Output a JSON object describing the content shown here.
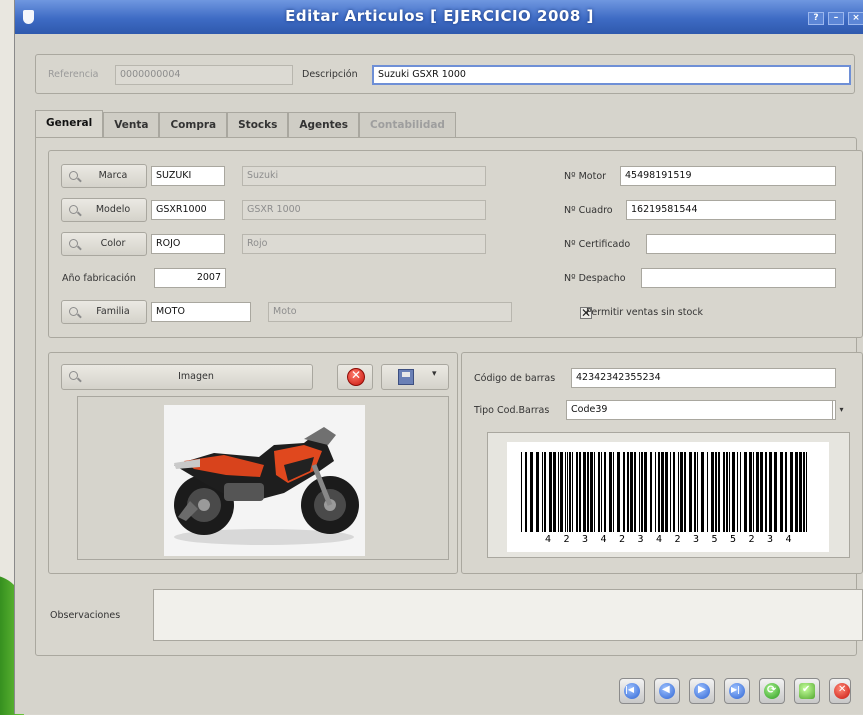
{
  "window": {
    "title": "Editar Articulos [ EJERCICIO 2008 ]",
    "buttons": [
      "?",
      "–",
      "×"
    ]
  },
  "header": {
    "referencia_label": "Referencia",
    "referencia_value": "0000000004",
    "descripcion_label": "Descripción",
    "descripcion_value": "Suzuki GSXR 1000"
  },
  "tabs": [
    {
      "label": "General",
      "active": true,
      "enabled": true
    },
    {
      "label": "Venta",
      "active": false,
      "enabled": true
    },
    {
      "label": "Compra",
      "active": false,
      "enabled": true
    },
    {
      "label": "Stocks",
      "active": false,
      "enabled": true
    },
    {
      "label": "Agentes",
      "active": false,
      "enabled": true
    },
    {
      "label": "Contabilidad",
      "active": false,
      "enabled": false
    }
  ],
  "general": {
    "marca": {
      "button": "Marca",
      "code": "SUZUKI",
      "name": "Suzuki"
    },
    "modelo": {
      "button": "Modelo",
      "code": "GSXR1000",
      "name": "GSXR 1000"
    },
    "color": {
      "button": "Color",
      "code": "ROJO",
      "name": "Rojo"
    },
    "anio": {
      "label": "Año fabricación",
      "value": "2007"
    },
    "familia": {
      "button": "Familia",
      "code": "MOTO",
      "name": "Moto"
    },
    "motor": {
      "label": "Nº Motor",
      "value": "45498191519"
    },
    "cuadro": {
      "label": "Nº Cuadro",
      "value": "16219581544"
    },
    "certificado": {
      "label": "Nº Certificado",
      "value": ""
    },
    "despacho": {
      "label": "Nº Despacho",
      "value": ""
    },
    "permitir": {
      "label": "Permitir ventas sin stock",
      "checked": true,
      "mark": "✕"
    }
  },
  "imagen": {
    "button": "Imagen",
    "dropdown_arrow": "▾"
  },
  "barcode": {
    "codigo_label": "Código de barras",
    "codigo_value": "42342342355234",
    "tipo_label": "Tipo Cod.Barras",
    "tipo_value": "Code39",
    "digits": [
      "4",
      "2",
      "3",
      "4",
      "2",
      "3",
      "4",
      "2",
      "3",
      "5",
      "5",
      "2",
      "3",
      "4"
    ]
  },
  "observaciones": {
    "label": "Observaciones",
    "value": ""
  },
  "colors": {
    "titlebar": "#3e6bc4",
    "background": "#d6d4cc",
    "focus_border": "#6e8fd6"
  },
  "icons": {
    "lookup": "magnifier-icon",
    "delete": "stop-icon",
    "save": "save-icon",
    "first": "first-record-icon",
    "prev": "previous-record-icon",
    "next": "next-record-icon",
    "last": "last-record-icon",
    "refresh": "refresh-icon",
    "accept": "accept-icon",
    "close": "close-icon"
  }
}
